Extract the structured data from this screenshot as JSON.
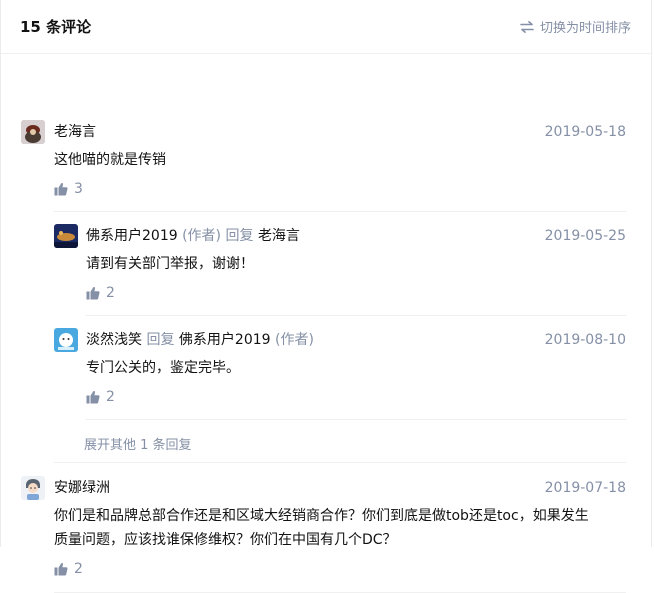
{
  "header": {
    "title": "15 条评论",
    "sort_label": "切换为时间排序",
    "sort_icon": "swap-icon"
  },
  "comments": [
    {
      "author": "老海言",
      "date": "2019-05-18",
      "content": "这他喵的就是传销",
      "likes": "3",
      "replies": [
        {
          "author": "佛系用户2019",
          "author_tag": "(作者)",
          "reply_word": "回复",
          "reply_to": "老海言",
          "date": "2019-05-25",
          "content": "请到有关部门举报，谢谢！",
          "likes": "2"
        },
        {
          "author": "淡然浅笑",
          "reply_word": "回复",
          "reply_to": "佛系用户2019",
          "reply_to_tag": "(作者)",
          "date": "2019-08-10",
          "content": "专门公关的，鉴定完毕。",
          "likes": "2"
        }
      ],
      "expand_label": "展开其他 1 条回复"
    },
    {
      "author": "安娜绿洲",
      "date": "2019-07-18",
      "content_line1": "你们是和品牌总部合作还是和区域大经销商合作？你们到底是做tob还是toc，如果发生",
      "content_line2": "质量问题，应该找谁保修维权？你们在中国有几个DC？",
      "likes": "2"
    }
  ],
  "colors": {
    "muted": "#8590a6",
    "text": "#121212",
    "divider": "#f0f0f0"
  }
}
